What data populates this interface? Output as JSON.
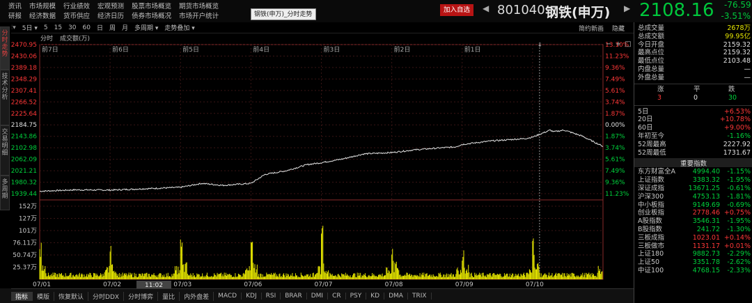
{
  "menu_row1": [
    "资讯",
    "市场规模",
    "行业绩效",
    "宏观预测",
    "股票市场概览",
    "期货市场概览"
  ],
  "menu_row2": [
    "研报",
    "经济数据",
    "货币供应",
    "经济日历",
    "债券市场概况",
    "市场开户统计"
  ],
  "tooltip": "钢铁(申万)_分时走势",
  "watch_label": "加入自选",
  "stock": {
    "code": "801040",
    "name": "钢铁(申万)",
    "price": "2108.16",
    "change": "-76.59",
    "change_pct": "-3.51%"
  },
  "left_tabs": [
    "分时走势",
    "技术分析",
    "交易明细",
    "多周期"
  ],
  "toolbar": {
    "items": [
      "5日",
      "5",
      "15",
      "30",
      "60",
      "日",
      "周",
      "月",
      "多周期",
      "走势叠加"
    ],
    "right": [
      "简约新画",
      "隐藏"
    ]
  },
  "subheader": [
    "分时",
    "成交额(万)"
  ],
  "axis": {
    "prices": [
      "2470.95",
      "2430.06",
      "2389.18",
      "2348.29",
      "2307.41",
      "2266.52",
      "2225.64",
      "2184.75",
      "2143.86",
      "2102.98",
      "2062.09",
      "2021.21",
      "1980.32",
      "1939.44"
    ],
    "pcts": [
      "13.10%",
      "11.23%",
      "9.36%",
      "7.49%",
      "5.61%",
      "3.74%",
      "1.87%",
      "0.00%",
      "1.87%",
      "3.74%",
      "5.61%",
      "7.49%",
      "9.36%",
      "11.23%"
    ],
    "vols": [
      "152万",
      "127万",
      "101万",
      "76.11万",
      "50.74万",
      "25.37万"
    ],
    "days": [
      "前7日",
      "前6日",
      "前5日",
      "前4日",
      "前3日",
      "前2日",
      "前1日"
    ],
    "dates": [
      "07/01",
      "07/02",
      "07/03",
      "07/06",
      "07/07",
      "07/08",
      "07/09",
      "07/10"
    ],
    "cursor_time": "11:02"
  },
  "right_panel": {
    "stats": [
      [
        "总成交量",
        "2678万"
      ],
      [
        "总成交额",
        "99.95亿"
      ],
      [
        "今日开盘",
        "2159.32"
      ],
      [
        "最高点位",
        "2159.32"
      ],
      [
        "最低点位",
        "2103.48"
      ],
      [
        "内盘总量",
        "—"
      ],
      [
        "外盘总量",
        "—"
      ]
    ],
    "breadth_labels": [
      "涨",
      "平",
      "跌"
    ],
    "breadth_values": [
      "3",
      "0",
      "30"
    ],
    "periods": [
      [
        "5日",
        "+6.53%"
      ],
      [
        "20日",
        "+10.78%"
      ],
      [
        "60日",
        "+9.00%"
      ],
      [
        "年初至今",
        "-1.16%"
      ],
      [
        "52周最高",
        "2227.92"
      ],
      [
        "52周最低",
        "1731.67"
      ]
    ],
    "index_title": "重要指数",
    "indices": [
      [
        "东方财富全A",
        "4994.40",
        "-1.15%"
      ],
      [
        "上证指数",
        "3383.32",
        "-1.95%"
      ],
      [
        "深证成指",
        "13671.25",
        "-0.61%"
      ],
      [
        "沪深300",
        "4753.13",
        "-1.81%"
      ],
      [
        "中小板指",
        "9149.69",
        "-0.69%"
      ],
      [
        "创业板指",
        "2778.46",
        "+0.75%"
      ],
      [
        "A股指数",
        "3546.31",
        "-1.95%"
      ],
      [
        "B股指数",
        "241.72",
        "-1.30%"
      ],
      [
        "三板成指",
        "1023.01",
        "+0.14%"
      ],
      [
        "三板做市",
        "1131.17",
        "+0.01%"
      ],
      [
        "上证180",
        "9882.73",
        "-2.29%"
      ],
      [
        "上证50",
        "3351.78",
        "-2.62%"
      ],
      [
        "中证100",
        "4768.15",
        "-2.33%"
      ]
    ]
  },
  "bottom_tabs": [
    "指标",
    "模版",
    "恢复默认",
    "分时DDX",
    "分时博弈",
    "量比",
    "内外盘差",
    "MACD",
    "KDJ",
    "RSI",
    "BRAR",
    "DMI",
    "CR",
    "PSY",
    "KD",
    "DMA",
    "TRIX"
  ],
  "colors": {
    "up": "#ff3838",
    "down": "#00d23c",
    "volume": "#e8e800",
    "accent": "#b81414"
  }
}
